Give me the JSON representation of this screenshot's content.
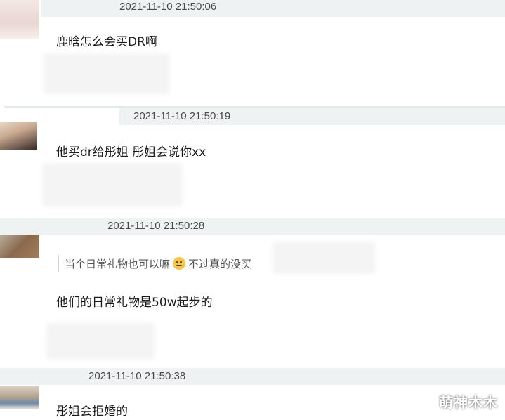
{
  "comments": [
    {
      "timestamp": "2021-11-10 21:50:06",
      "text": "鹿晗怎么会买DR啊"
    },
    {
      "timestamp": "2021-11-10 21:50:19",
      "text": "他买dr给彤姐 彤姐会说你xx"
    },
    {
      "timestamp": "2021-11-10 21:50:28",
      "quote": "当个日常礼物也可以嘛",
      "quote_tail": "不过真的没买",
      "emoji": "sad-face-emoji",
      "text": "他们的日常礼物是50w起步的"
    },
    {
      "timestamp": "2021-11-10 21:50:38",
      "text": "彤姐会拒婚的"
    }
  ],
  "watermark": "萌神木木",
  "colors": {
    "header_bg": "#eef2f2",
    "timestamp": "#4a4a4a",
    "text": "#1a1a1a"
  }
}
